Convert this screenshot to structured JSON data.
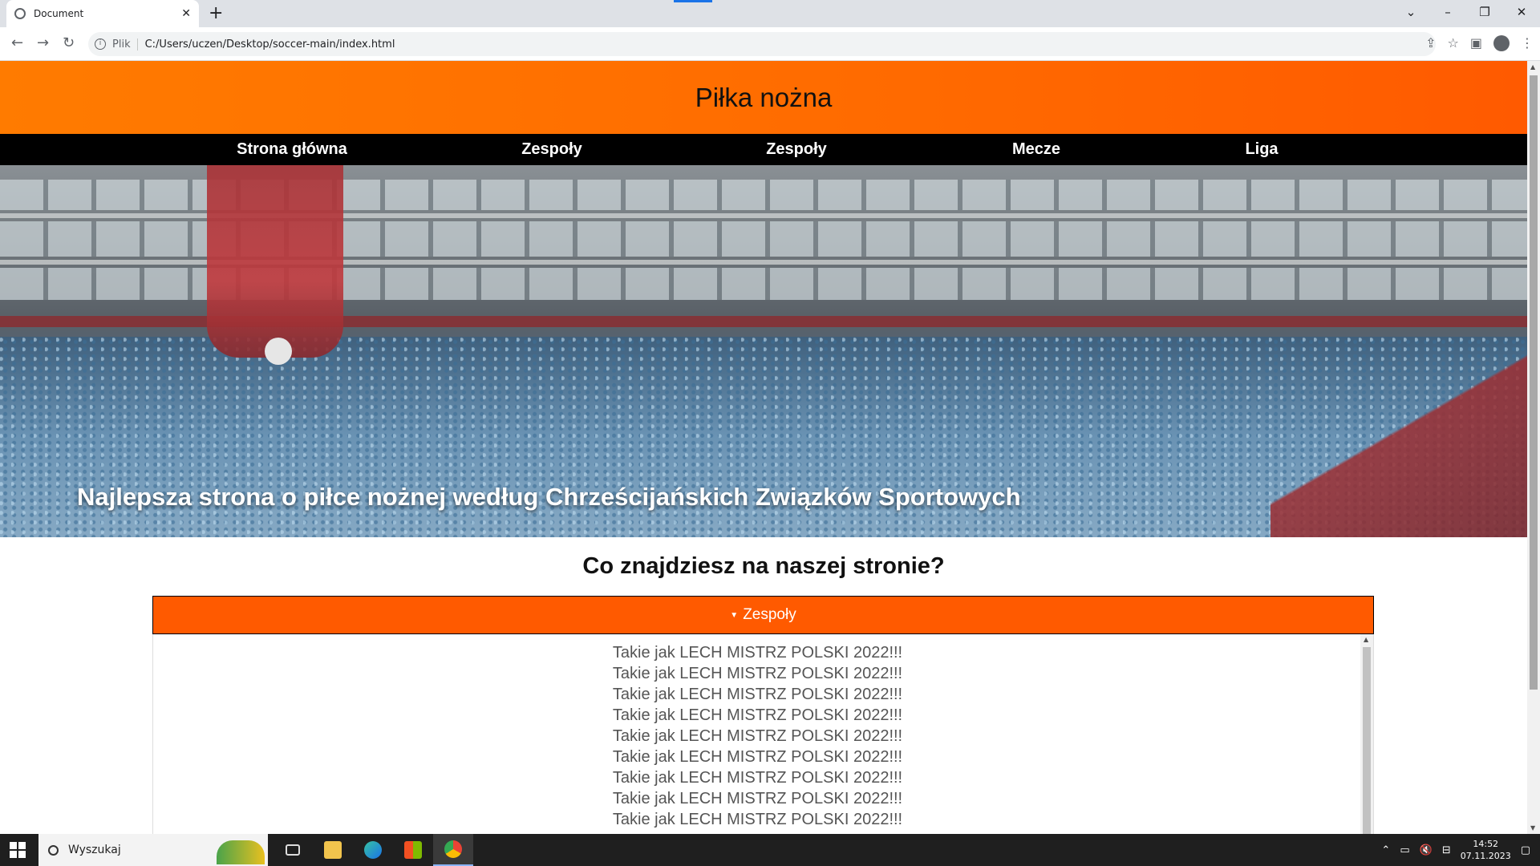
{
  "browser": {
    "tab_title": "Document",
    "tab_close": "✕",
    "new_tab": "+",
    "win_controls": [
      "⌄",
      "–",
      "❐",
      "✕"
    ],
    "back": "←",
    "forward": "→",
    "reload": "↻",
    "info": "i",
    "address_prefix": "Plik",
    "url": "C:/Users/uczen/Desktop/soccer-main/index.html",
    "toolbar_icons": [
      "⇪",
      "☆",
      "▣",
      "⋮"
    ]
  },
  "site": {
    "title": "Piłka nożna",
    "nav": [
      "Strona główna",
      "Zespoły",
      "Zespoły",
      "Mecze",
      "Liga"
    ],
    "hero_caption": "Najlepsza strona o piłce nożnej według Chrześcijańskich Związków Sportowych",
    "section_title": "Co znajdziesz na naszej stronie?",
    "accordion": {
      "caret": "▼",
      "label": "Zespoły",
      "items": [
        "Takie jak LECH MISTRZ POLSKI 2022!!!",
        "Takie jak LECH MISTRZ POLSKI 2022!!!",
        "Takie jak LECH MISTRZ POLSKI 2022!!!",
        "Takie jak LECH MISTRZ POLSKI 2022!!!",
        "Takie jak LECH MISTRZ POLSKI 2022!!!",
        "Takie jak LECH MISTRZ POLSKI 2022!!!",
        "Takie jak LECH MISTRZ POLSKI 2022!!!",
        "Takie jak LECH MISTRZ POLSKI 2022!!!",
        "Takie jak LECH MISTRZ POLSKI 2022!!!"
      ]
    }
  },
  "taskbar": {
    "search_placeholder": "Wyszukaj",
    "apps": [
      "task-view",
      "file-explorer",
      "edge",
      "store",
      "chrome"
    ],
    "tray_icons": [
      "⌃",
      "▭",
      "🔇",
      "⊟"
    ],
    "time": "14:52",
    "date": "07.11.2023",
    "notifications": "▢"
  },
  "colors": {
    "header_orange": "#ff6a00",
    "accordion_orange": "#ff5a00",
    "nav_black": "#000000"
  }
}
